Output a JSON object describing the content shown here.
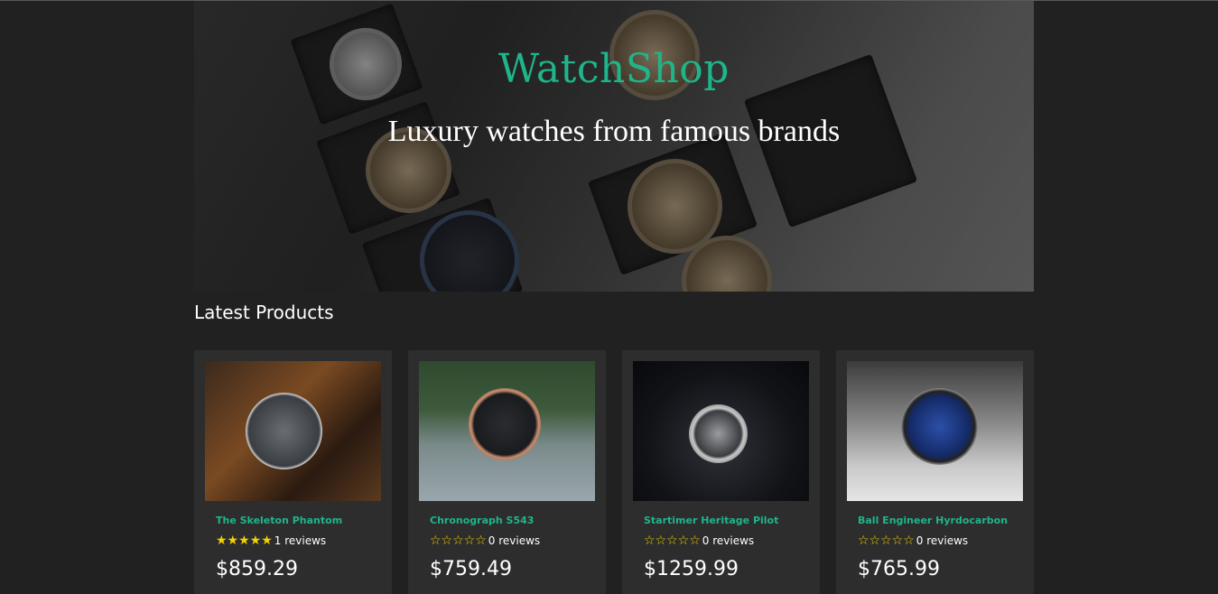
{
  "hero": {
    "title": "WatchShop",
    "subtitle": "Luxury watches from famous brands"
  },
  "section": {
    "title": "Latest Products"
  },
  "products": [
    {
      "name": "The Skeleton Phantom",
      "rating": 5,
      "reviews_text": "1 reviews",
      "price": "$859.29"
    },
    {
      "name": "Chronograph S543",
      "rating": 0,
      "reviews_text": "0 reviews",
      "price": "$759.49"
    },
    {
      "name": "Startimer Heritage Pilot",
      "rating": 0,
      "reviews_text": "0 reviews",
      "price": "$1259.99"
    },
    {
      "name": "Ball Engineer Hyrdocarbon",
      "rating": 0,
      "reviews_text": "0 reviews",
      "price": "$765.99"
    }
  ],
  "colors": {
    "background": "#212121",
    "card": "#2d2d2d",
    "accent": "#1fb58a",
    "star": "#f5d100"
  },
  "icons": {
    "star_filled": "star-filled-icon",
    "star_empty": "star-empty-icon"
  }
}
